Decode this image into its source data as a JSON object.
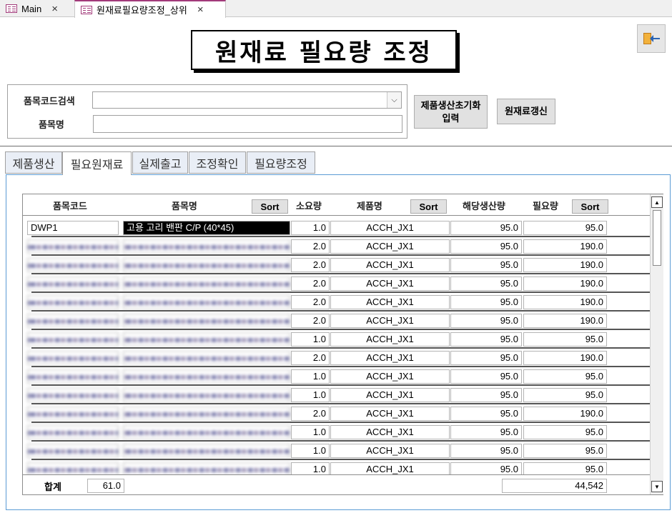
{
  "doc_tabs": [
    {
      "label": "Main",
      "close": "×"
    },
    {
      "label": "원재료필요량조정_상위",
      "close": "×"
    }
  ],
  "header": {
    "title": "원재료 필요량 조정",
    "exit_icon": "exit-door-icon"
  },
  "search": {
    "code_label": "품목코드검색",
    "code_value": "",
    "name_label": "품목명",
    "name_value": "",
    "dropdown_glyph": "⌵"
  },
  "buttons": {
    "init_line1": "제품생산초기화",
    "init_line2": "입력",
    "update": "원재료갱신"
  },
  "tabs": [
    "제품생산",
    "필요원재료",
    "실제출고",
    "조정확인",
    "필요량조정"
  ],
  "active_tab": "필요원재료",
  "grid": {
    "headers": {
      "code": "품목코드",
      "name": "품목명",
      "qty": "소요량",
      "product": "제품명",
      "made": "해당생산량",
      "need": "필요량"
    },
    "sort_label": "Sort",
    "rows": [
      {
        "code": "DWP1",
        "name": "고용 고리 밴판 C/P (40*45)",
        "qty": "1.0",
        "product": "ACCH_JX1",
        "made": "95.0",
        "need": "95.0"
      },
      {
        "code": "",
        "name": "",
        "qty": "2.0",
        "product": "ACCH_JX1",
        "made": "95.0",
        "need": "190.0"
      },
      {
        "code": "",
        "name": "",
        "qty": "2.0",
        "product": "ACCH_JX1",
        "made": "95.0",
        "need": "190.0"
      },
      {
        "code": "",
        "name": "",
        "qty": "2.0",
        "product": "ACCH_JX1",
        "made": "95.0",
        "need": "190.0"
      },
      {
        "code": "",
        "name": "",
        "qty": "2.0",
        "product": "ACCH_JX1",
        "made": "95.0",
        "need": "190.0"
      },
      {
        "code": "",
        "name": "",
        "qty": "2.0",
        "product": "ACCH_JX1",
        "made": "95.0",
        "need": "190.0"
      },
      {
        "code": "",
        "name": "",
        "qty": "1.0",
        "product": "ACCH_JX1",
        "made": "95.0",
        "need": "95.0"
      },
      {
        "code": "",
        "name": "",
        "qty": "2.0",
        "product": "ACCH_JX1",
        "made": "95.0",
        "need": "190.0"
      },
      {
        "code": "",
        "name": "",
        "qty": "1.0",
        "product": "ACCH_JX1",
        "made": "95.0",
        "need": "95.0"
      },
      {
        "code": "",
        "name": "",
        "qty": "1.0",
        "product": "ACCH_JX1",
        "made": "95.0",
        "need": "95.0"
      },
      {
        "code": "",
        "name": "",
        "qty": "2.0",
        "product": "ACCH_JX1",
        "made": "95.0",
        "need": "190.0"
      },
      {
        "code": "",
        "name": "",
        "qty": "1.0",
        "product": "ACCH_JX1",
        "made": "95.0",
        "need": "95.0"
      },
      {
        "code": "",
        "name": "",
        "qty": "1.0",
        "product": "ACCH_JX1",
        "made": "95.0",
        "need": "95.0"
      },
      {
        "code": "",
        "name": "",
        "qty": "1.0",
        "product": "ACCH_JX1",
        "made": "95.0",
        "need": "95.0"
      }
    ],
    "footer": {
      "label": "합계",
      "qty_total": "61.0",
      "need_total": "44,542"
    }
  }
}
